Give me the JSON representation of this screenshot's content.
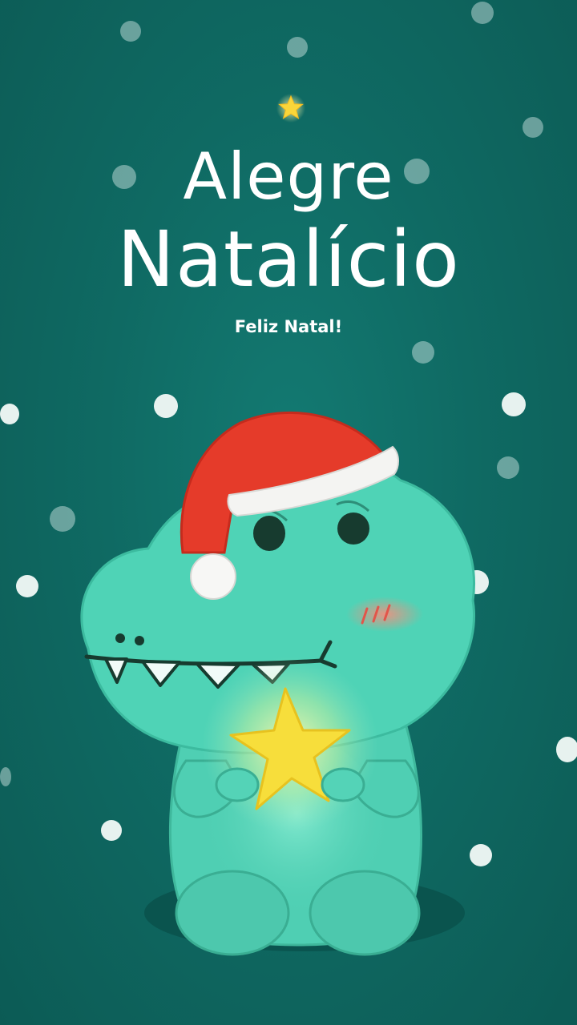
{
  "card": {
    "title_line1": "Alegre",
    "title_line2": "Natalício",
    "subtitle": "Feliz Natal!"
  },
  "illustration": {
    "subject": "dinosaur-with-santa-hat-holding-star",
    "icon": "star-icon"
  },
  "colors": {
    "background": "#0f6a63",
    "dino": "#4fcfb3",
    "hat": "#e53b2a",
    "star": "#f7de3b",
    "text": "#ffffff"
  }
}
